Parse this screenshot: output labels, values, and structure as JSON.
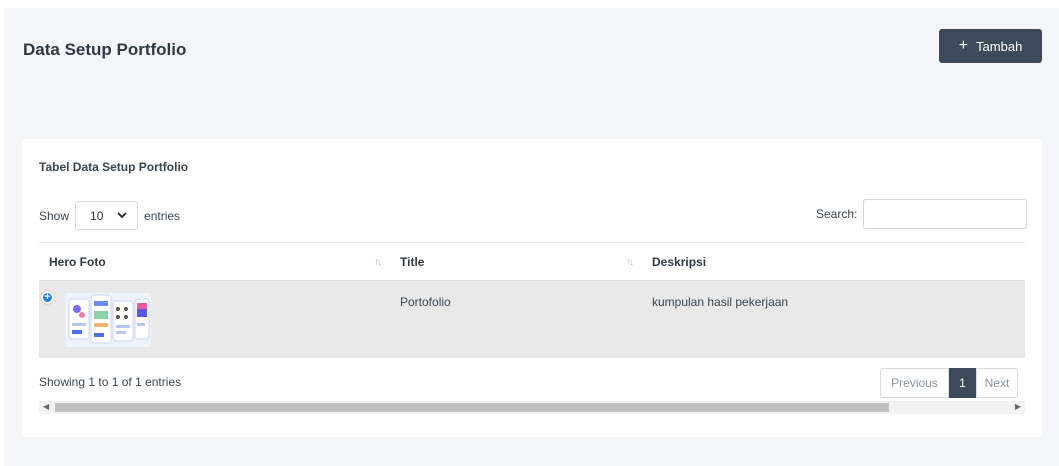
{
  "header": {
    "title": "Data Setup Portfolio",
    "add_button": "Tambah",
    "add_icon": "plus-icon"
  },
  "card": {
    "title": "Tabel Data Setup Portfolio",
    "show_label": "Show",
    "entries_label": "entries",
    "page_length": "10",
    "search_label": "Search:",
    "search_value": ""
  },
  "table": {
    "headers": [
      "Hero Foto",
      "Title",
      "Deskripsi"
    ],
    "rows": [
      {
        "title": "Portofolio",
        "deskripsi": "kumpulan hasil pekerjaan"
      }
    ]
  },
  "footer": {
    "info": "Showing 1 to 1 of 1 entries",
    "prev": "Previous",
    "current_page": "1",
    "next": "Next"
  },
  "colors": {
    "accent": "#3d4a5c",
    "background": "#f4f6f9",
    "row_bg": "#e9e9ea",
    "expand_icon": "#1f7fd6"
  }
}
